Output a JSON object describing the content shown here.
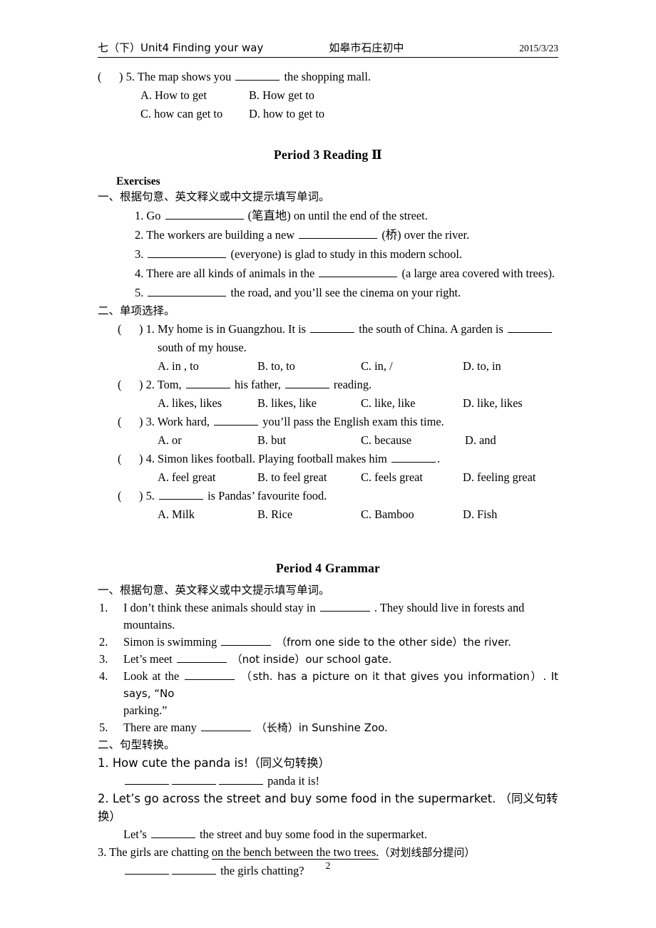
{
  "header": {
    "left": "七（下）Unit4 Finding your way",
    "middle": "如皋市石庄初中",
    "right": "2015/3/23"
  },
  "carryover_question": {
    "stem_prefix": "(      ) 5. The map shows you ",
    "stem_suffix": " the shopping mall.",
    "options_row1": [
      "A. How to get",
      "B. How get to"
    ],
    "options_row2": [
      "C. how can get to",
      "D. how to get to"
    ]
  },
  "period3": {
    "title": "Period 3    Reading  Ⅱ",
    "exercises_label": "Exercises",
    "section1_heading": "一、根据句意、英文释义或中文提示填写单词。",
    "fill_items": [
      {
        "num": "1. ",
        "before": "Go ",
        "after": " (笔直地) on until the end of the street."
      },
      {
        "num": "2. ",
        "before": "The workers are building a new ",
        "after": " (桥) over the river."
      },
      {
        "num": "3. ",
        "before": "",
        "after": " (everyone) is glad to study in this modern school."
      },
      {
        "num": "4. ",
        "before": "There are all kinds of animals in the ",
        "after": " (a large area covered with trees)."
      },
      {
        "num": "5. ",
        "before": "",
        "after": " the road, and you’ll see the cinema on your right."
      }
    ],
    "section2_heading": "二、单项选择。",
    "mc_items": [
      {
        "marker": "(      ) 1. ",
        "stem_a": "My home is in Guangzhou. It is ",
        "stem_b": " the south of China. A garden is ",
        "stem_c": "",
        "stem_wrap": "south of my house.",
        "options": [
          "A. in , to",
          "B. to, to",
          "C. in, /",
          "D. to, in"
        ]
      },
      {
        "marker": "(      ) 2. ",
        "stem_a": "Tom, ",
        "stem_b": " his father, ",
        "stem_c": " reading.",
        "stem_wrap": "",
        "options": [
          "A. likes, likes",
          "B. likes, like",
          "C. like, like",
          "D. like, likes"
        ]
      },
      {
        "marker": "(      ) 3. ",
        "stem_a": "Work hard, ",
        "stem_b": " you’ll pass the English exam this time.",
        "stem_c": "",
        "stem_wrap": "",
        "options": [
          "A. or",
          "B. but",
          "C. because",
          "D. and"
        ]
      },
      {
        "marker": "(      ) 4. ",
        "stem_a": "Simon likes football. Playing football makes him ",
        "stem_b": ".",
        "stem_c": "",
        "stem_wrap": "",
        "options": [
          "A. feel great",
          "B. to feel great",
          "C. feels great",
          "D. feeling great"
        ]
      },
      {
        "marker": "(      ) 5. ",
        "stem_a": "",
        "stem_b": " is Pandas’ favourite food.",
        "stem_c": "",
        "stem_wrap": "",
        "options": [
          "A. Milk",
          "B. Rice",
          "C. Bamboo",
          "D. Fish"
        ]
      }
    ]
  },
  "period4": {
    "title": "Period 4    Grammar",
    "section1_heading": "一、根据句意、英文释义或中文提示填写单词。",
    "grammar_items": [
      {
        "num": "1.",
        "before": "I don’t think these animals should stay in ",
        "after": " . They should live in forests and",
        "wrap": "mountains."
      },
      {
        "num": "2.",
        "before": "Simon is swimming ",
        "after": " （from one side to the other side）the river.",
        "wrap": ""
      },
      {
        "num": "3.",
        "before": "Let’s meet ",
        "after": " （not inside）our school gate.",
        "wrap": ""
      },
      {
        "num": "4.",
        "before": "Look at the ",
        "after": " （sth. has a picture on it that gives you information）. It says, “No",
        "wrap": "parking.”"
      },
      {
        "num": "5.",
        "before": "There are many ",
        "after": " （长椅）in Sunshine Zoo.",
        "wrap": ""
      }
    ],
    "section2_heading": "二、句型转换。",
    "transform_items": [
      {
        "question": "1. How cute the panda is!（同义句转换）",
        "answer_before": "",
        "answer_after": " panda it is!",
        "blanks": 3
      },
      {
        "question": "2. Let’s go across the street and buy some food in the supermarket. （同义句转换）",
        "answer_before": "Let’s ",
        "answer_after": " the street and buy some food in the supermarket.",
        "blanks": 1
      },
      {
        "question_pre": "3. The girls are chatting ",
        "question_underlined": "on the bench between the two trees.",
        "question_post": "（对划线部分提问）",
        "answer_before": "",
        "answer_after": " the girls chatting?",
        "blanks": 2
      }
    ]
  },
  "footer": {
    "page_number": "2"
  }
}
